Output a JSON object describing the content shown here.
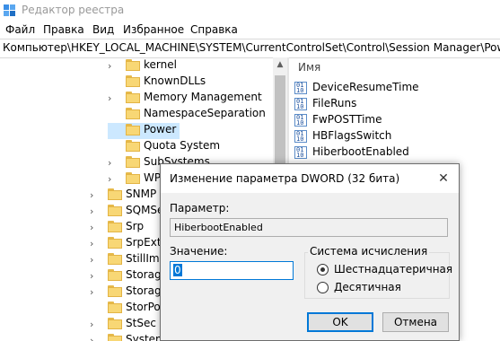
{
  "window": {
    "title": "Редактор реестра"
  },
  "menu": [
    "Файл",
    "Правка",
    "Вид",
    "Избранное",
    "Справка"
  ],
  "address": "Компьютер\\HKEY_LOCAL_MACHINE\\SYSTEM\\CurrentControlSet\\Control\\Session Manager\\Power",
  "tree": {
    "items": [
      {
        "label": "kernel"
      },
      {
        "label": "KnownDLLs"
      },
      {
        "label": "Memory Management"
      },
      {
        "label": "NamespaceSeparation"
      },
      {
        "label": "Power"
      },
      {
        "label": "Quota System"
      },
      {
        "label": "SubSystems"
      },
      {
        "label": "WPA"
      },
      {
        "label": "SNMP"
      },
      {
        "label": "SQMServ"
      },
      {
        "label": "Srp"
      },
      {
        "label": "SrpExten"
      },
      {
        "label": "StillImag"
      },
      {
        "label": "Storage"
      },
      {
        "label": "Storage"
      },
      {
        "label": "StorPort"
      },
      {
        "label": "StSec"
      },
      {
        "label": "System"
      }
    ]
  },
  "values_pane": {
    "column_name": "Имя",
    "items": [
      {
        "label": "DeviceResumeTime"
      },
      {
        "label": "FileRuns"
      },
      {
        "label": "FwPOSTTime"
      },
      {
        "label": "HBFlagsSwitch"
      },
      {
        "label": "HiberbootEnabled"
      }
    ]
  },
  "dialog": {
    "title": "Изменение параметра DWORD (32 бита)",
    "close_symbol": "✕",
    "param_label": "Параметр:",
    "param_value": "HiberbootEnabled",
    "value_label": "Значение:",
    "value": "0",
    "base_label": "Система исчисления",
    "base_options": [
      {
        "label": "Шестнадцатеричная",
        "selected": true
      },
      {
        "label": "Десятичная",
        "selected": false
      }
    ],
    "ok_label": "OK",
    "cancel_label": "Отмена"
  },
  "colors": {
    "selection": "#cce8ff",
    "accent": "#0078d7",
    "folder": "#f8d775"
  },
  "icons": {
    "app": "registry-editor-icon",
    "folder": "folder-icon",
    "chevron": "chevron-right-icon",
    "value": "reg-binary-value-icon",
    "close": "close-icon"
  }
}
